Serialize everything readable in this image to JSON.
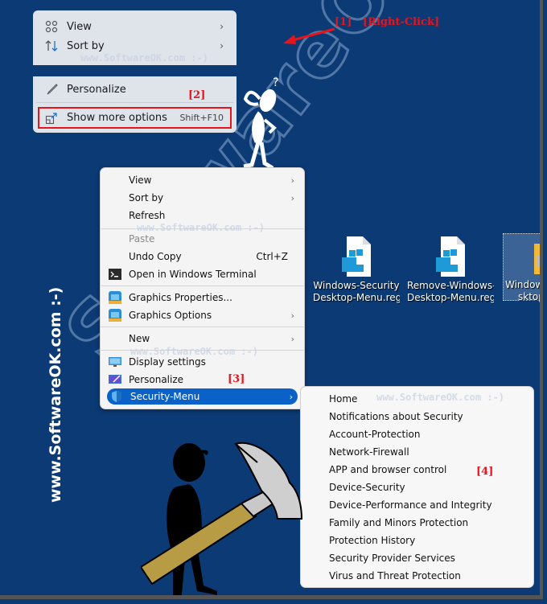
{
  "watermarks": {
    "diagonal": "SoftwareOK.com",
    "vertical": "www.SoftwareOK.com :-)",
    "small": "www.SoftwareOK.com :-)"
  },
  "annotations": {
    "step1": "[1]",
    "step1_label": "[Right-Click]",
    "step2": "[2]",
    "step3": "[3]",
    "step4": "[4]"
  },
  "colors": {
    "desktop_bg": "#0b3a74",
    "annotation_red": "#e8141b",
    "selection_blue": "#0a62c9"
  },
  "win11_menu": {
    "items": [
      {
        "icon": "grid-view-icon",
        "label": "View",
        "submenu": true
      },
      {
        "icon": "sort-icon",
        "label": "Sort by",
        "submenu": true
      }
    ],
    "bottom_items": [
      {
        "icon": "brush-icon",
        "label": "Personalize"
      },
      {
        "icon": "open-external-icon",
        "label": "Show more options",
        "shortcut": "Shift+F10"
      }
    ]
  },
  "classic_menu": {
    "items": [
      {
        "label": "View",
        "submenu": true
      },
      {
        "label": "Sort by",
        "submenu": true
      },
      {
        "label": "Refresh"
      },
      {
        "label": "Paste",
        "disabled": true
      },
      {
        "label": "Undo Copy",
        "shortcut": "Ctrl+Z"
      },
      {
        "label": "Open in Windows Terminal",
        "icon": "terminal-icon"
      },
      {
        "label": "Graphics Properties...",
        "icon": "intel-graphics-icon"
      },
      {
        "label": "Graphics Options",
        "icon": "intel-graphics-icon",
        "submenu": true
      },
      {
        "label": "New",
        "submenu": true
      },
      {
        "label": "Display settings",
        "icon": "display-icon"
      },
      {
        "label": "Personalize",
        "icon": "personalize-icon"
      },
      {
        "label": "Security-Menu",
        "icon": "shield-icon",
        "submenu": true,
        "selected": true
      }
    ]
  },
  "security_submenu": {
    "items": [
      "Home",
      "Notifications about Security",
      "Account-Protection",
      "Network-Firewall",
      "APP and browser control",
      "Device-Security",
      "Device-Performance and Integrity",
      "Family and Minors Protection",
      "Protection History",
      "Security Provider Services",
      "Virus and Threat Protection"
    ]
  },
  "desktop_icons": [
    {
      "line1": "Windows-Security",
      "line2": "Desktop-Menu.reg"
    },
    {
      "line1": "Remove-Windows-...",
      "line2": "Desktop-Menu.reg"
    },
    {
      "line1": "Windows",
      "line2": "sktop-"
    }
  ]
}
